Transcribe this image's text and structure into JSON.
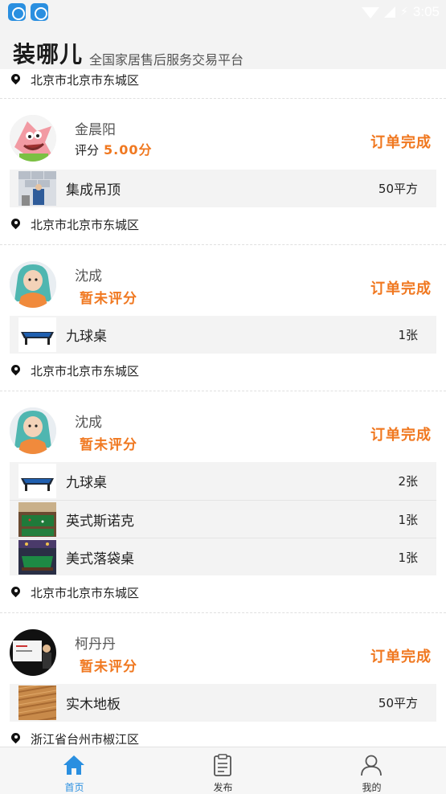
{
  "statusbar": {
    "time": "3:05"
  },
  "header": {
    "brand": "装哪儿",
    "subtitle": "全国家居售后服务交易平台"
  },
  "top_location": "北京市北京市东城区",
  "orders": [
    {
      "name": "金晨阳",
      "rating_label": "评分",
      "rating_value": "5.00分",
      "status": "订单完成",
      "items": [
        {
          "name": "集成吊顶",
          "qty": "50平方",
          "thumb": "ceiling-photo"
        }
      ],
      "location": "北京市北京市东城区"
    },
    {
      "name": "沈成",
      "no_rating": "暂未评分",
      "status": "订单完成",
      "items": [
        {
          "name": "九球桌",
          "qty": "1张",
          "thumb": "pool-table-photo"
        }
      ],
      "location": "北京市北京市东城区"
    },
    {
      "name": "沈成",
      "no_rating": "暂未评分",
      "status": "订单完成",
      "items": [
        {
          "name": "九球桌",
          "qty": "2张",
          "thumb": "pool-table-photo"
        },
        {
          "name": "英式斯诺克",
          "qty": "1张",
          "thumb": "snooker-hall-photo"
        },
        {
          "name": "美式落袋桌",
          "qty": "1张",
          "thumb": "pocket-table-photo"
        }
      ],
      "location": "北京市北京市东城区"
    },
    {
      "name": "柯丹丹",
      "no_rating": "暂未评分",
      "status": "订单完成",
      "items": [
        {
          "name": "实木地板",
          "qty": "50平方",
          "thumb": "wood-floor-photo"
        }
      ],
      "location": "浙江省台州市椒江区"
    }
  ],
  "nav": {
    "home": "首页",
    "publish": "发布",
    "mine": "我的"
  },
  "colors": {
    "accent": "#f07820",
    "active_tab": "#2a8fe0"
  }
}
